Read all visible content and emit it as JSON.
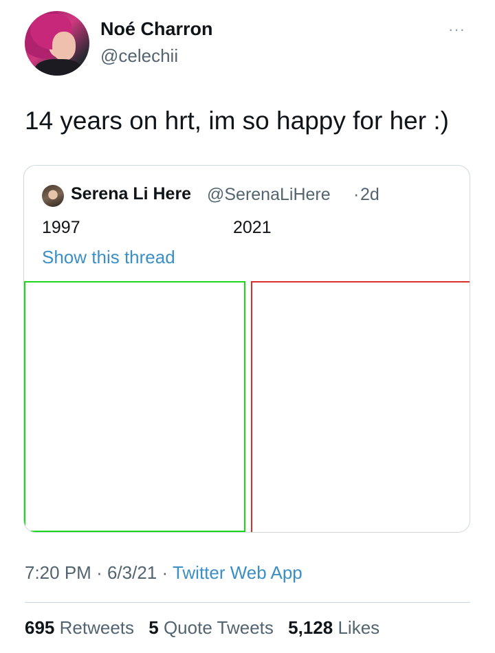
{
  "author": {
    "name": "Noé Charron",
    "handle": "@celechii"
  },
  "more_icon": "···",
  "tweet": {
    "text": "14 years on hrt, im so happy for her :)"
  },
  "quoted_tweet": {
    "name": "Serena Li Here",
    "handle": "@SerenaLiHere",
    "separator": "·",
    "time": "2d",
    "year_left": "1997",
    "year_right": "2021",
    "show_thread": "Show this thread",
    "photo_left_border_color": "#19d819",
    "photo_right_border_color": "#de2c2c"
  },
  "meta": {
    "time": "7:20 PM",
    "date": "6/3/21",
    "separator": "·",
    "source": "Twitter Web App"
  },
  "stats": {
    "retweets_count": "695",
    "retweets_label": "Retweets",
    "quotes_count": "5",
    "quotes_label": "Quote Tweets",
    "likes_count": "5,128",
    "likes_label": "Likes"
  }
}
